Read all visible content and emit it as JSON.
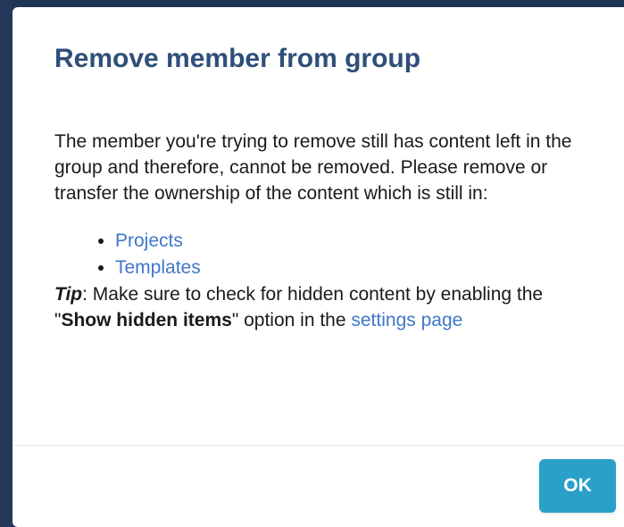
{
  "dialog": {
    "title": "Remove member from group",
    "message": "The member you're trying to remove still has content left in the group and therefore, cannot be removed. Please remove or transfer the ownership of the content which is still in:",
    "content_items": [
      "Projects",
      "Templates"
    ],
    "tip": {
      "label": "Tip",
      "text_before": ": Make sure to check for hidden content by enabling the \"",
      "bold_text": "Show hidden items",
      "text_after": "\" option in the ",
      "link_text": "settings page"
    },
    "ok_button": "OK"
  },
  "colors": {
    "title": "#2f4e79",
    "link": "#3f78c8",
    "button": "#2aa0c9",
    "backdrop": "#1f3556"
  }
}
